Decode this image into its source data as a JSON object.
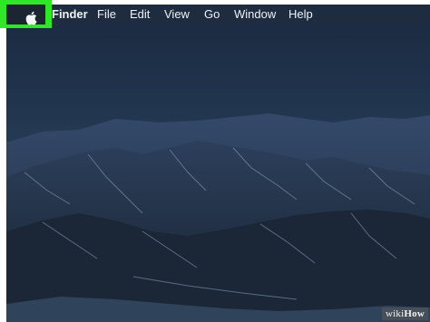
{
  "menubar": {
    "apple_icon": "apple-logo-icon",
    "items": [
      "Finder",
      "File",
      "Edit",
      "View",
      "Go",
      "Window",
      "Help"
    ],
    "highlight_color": "#2ee826"
  },
  "watermark": {
    "text_part1": "wiki",
    "text_part2": "How"
  },
  "colors": {
    "sky": "#1f3147",
    "mountains": "#2b3c55",
    "snow": "#8fa6c2"
  }
}
